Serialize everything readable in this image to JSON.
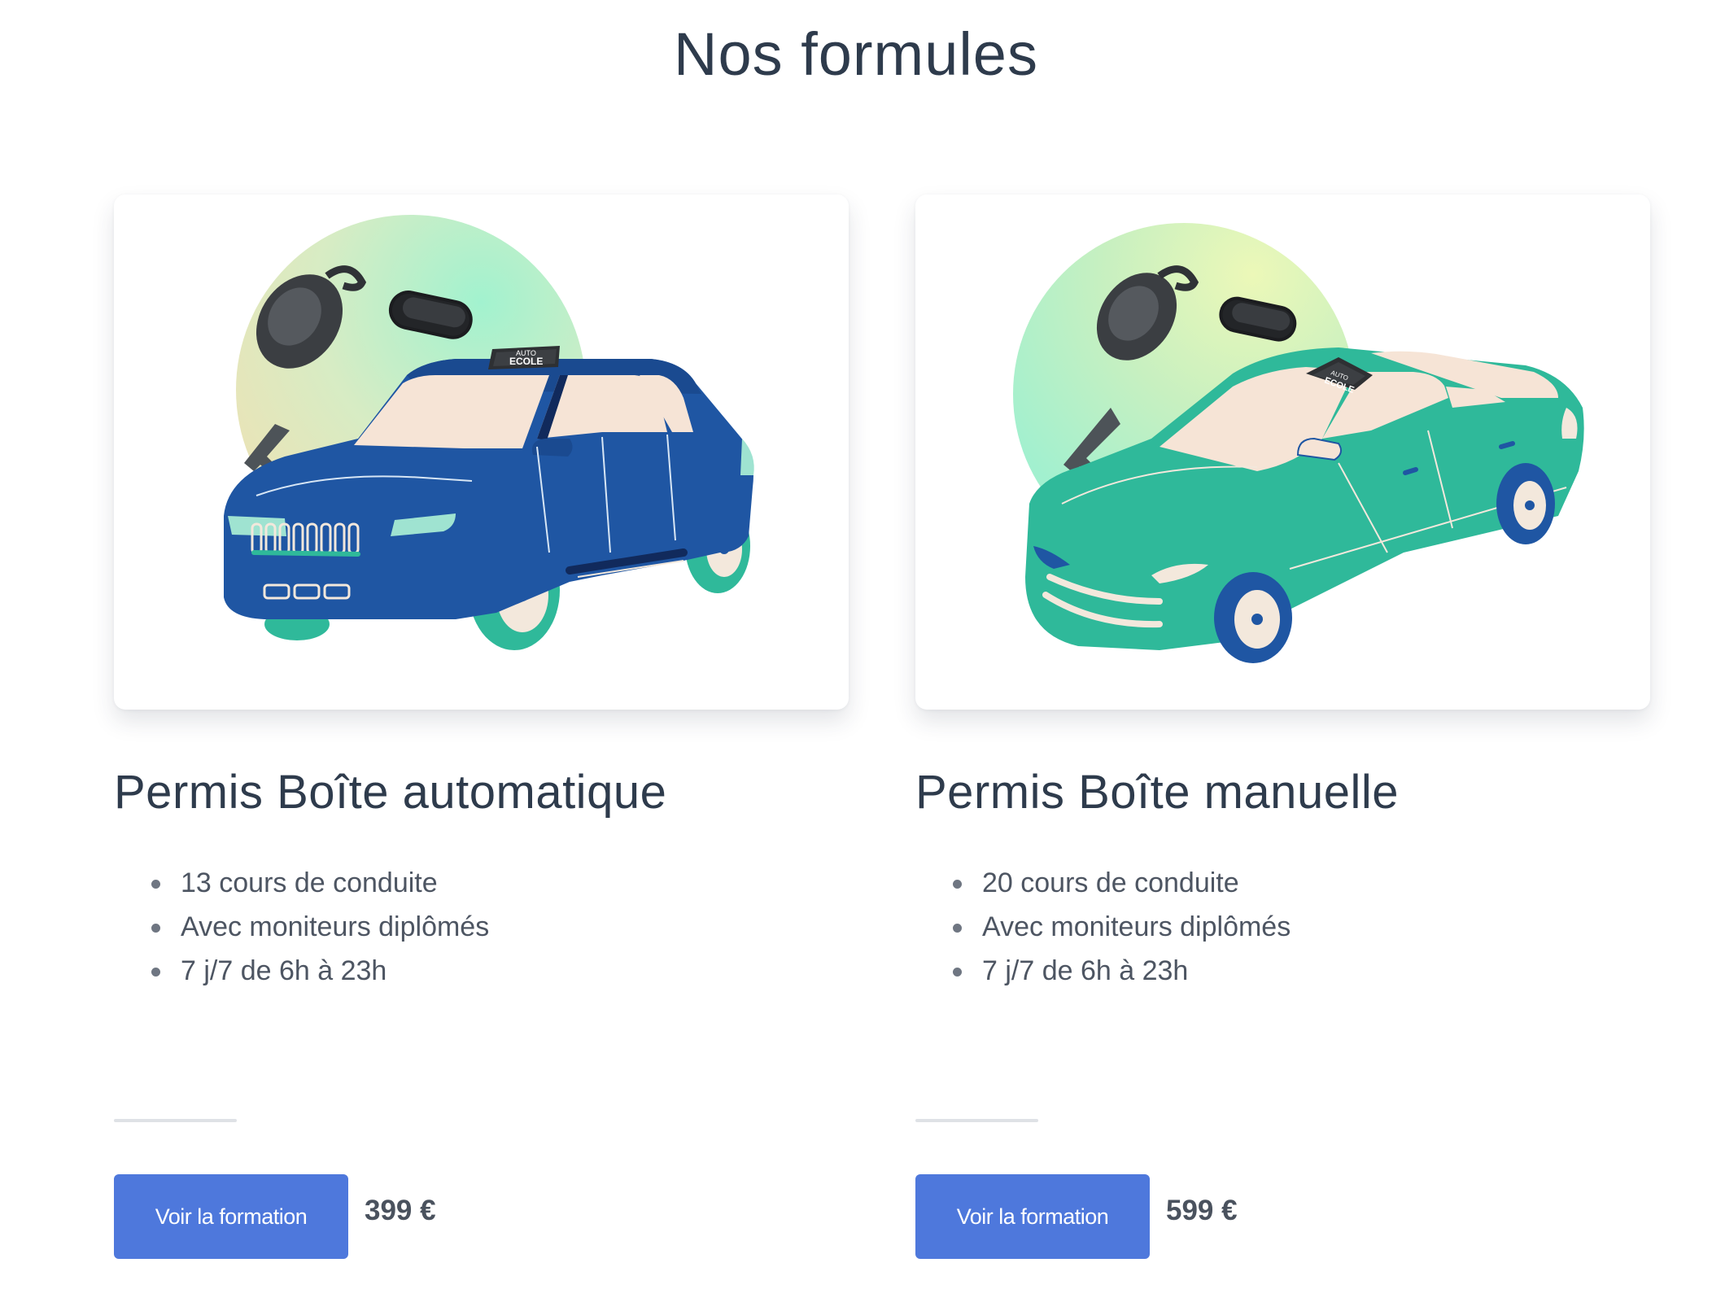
{
  "page": {
    "title": "Nos formules"
  },
  "plans": [
    {
      "title": "Permis Boîte automatique",
      "features": [
        "13 cours de conduite",
        "Avec moniteurs diplômés",
        "7 j/7 de 6h à 23h"
      ],
      "button_label": "Voir la formation",
      "price": "399 €",
      "illustration": {
        "subject": "blue-suv-with-car-key",
        "sign_top": "AUTO",
        "sign_bottom": "ECOLE",
        "car_color": "#1f56a3",
        "wheel_color": "#2fb99a"
      }
    },
    {
      "title": "Permis Boîte manuelle",
      "features": [
        "20 cours de conduite",
        "Avec moniteurs diplômés",
        "7 j/7 de 6h à 23h"
      ],
      "button_label": "Voir la formation",
      "price": "599 €",
      "illustration": {
        "subject": "green-sedan-with-car-key",
        "sign_top": "AUTO",
        "sign_bottom": "ECOLE",
        "car_color": "#2fb99a",
        "wheel_color": "#1f56a3"
      }
    }
  ],
  "colors": {
    "button": "#4e78dc",
    "heading": "#2e3b4c",
    "body_text": "#4d5562",
    "divider": "#dfe2e6"
  }
}
